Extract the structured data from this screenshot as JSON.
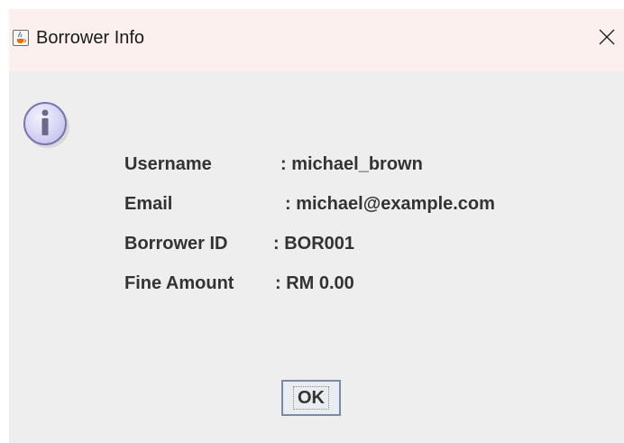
{
  "window": {
    "title": "Borrower Info",
    "app_icon": "java-cup-icon",
    "close_icon": "close-icon"
  },
  "message": {
    "icon": "info-icon",
    "rows": [
      {
        "label": "Username",
        "value": ": michael_brown"
      },
      {
        "label": "Email",
        "value": ": michael@example.com"
      },
      {
        "label": "Borrower ID",
        "value": ": BOR001"
      },
      {
        "label": "Fine Amount",
        "value": ": RM 0.00"
      }
    ]
  },
  "buttons": {
    "ok_label": "OK"
  },
  "colors": {
    "titlebar": "#fbf0ee",
    "dialog_bg": "#eeeeee",
    "text": "#333333",
    "info_icon_fill": "#d8d8f4",
    "info_icon_border": "#7a74b0"
  }
}
